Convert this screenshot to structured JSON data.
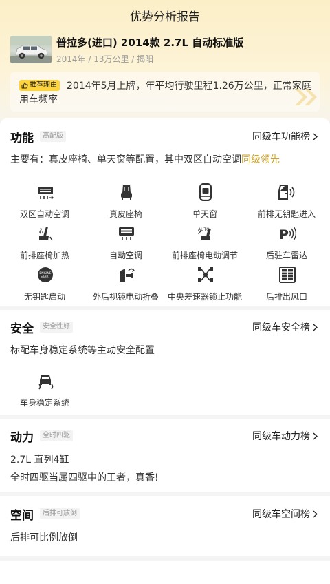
{
  "page": {
    "title": "优势分析报告"
  },
  "car": {
    "name": "普拉多(进口) 2014款 2.7L 自动标准版",
    "meta": "2014年 / 13万公里 / 揭阳"
  },
  "reason": {
    "tag": "推荐理由",
    "text": "2014年5月上牌，年平均行驶里程1.26万公里，正常家庭用车频率"
  },
  "sections": {
    "function": {
      "title": "功能",
      "tag": "高配版",
      "link": "同级车功能榜",
      "desc_prefix": "主要有：真皮座椅、单天窗等配置，其中双区自动空调",
      "desc_highlight": "同级领先",
      "features": [
        {
          "label": "双区自动空调",
          "icon": "dual-zone-ac-icon"
        },
        {
          "label": "真皮座椅",
          "icon": "leather-seat-icon"
        },
        {
          "label": "单天窗",
          "icon": "sunroof-icon"
        },
        {
          "label": "前排无钥匙进入",
          "icon": "keyless-entry-icon"
        },
        {
          "label": "前排座椅加热",
          "icon": "seat-heating-icon"
        },
        {
          "label": "自动空调",
          "icon": "auto-ac-icon"
        },
        {
          "label": "前排座椅电动调节",
          "icon": "power-seat-icon"
        },
        {
          "label": "后驻车雷达",
          "icon": "parking-radar-icon"
        },
        {
          "label": "无钥匙启动",
          "icon": "keyless-start-icon"
        },
        {
          "label": "外后视镜电动折叠",
          "icon": "mirror-fold-icon"
        },
        {
          "label": "中央差速器锁止功能",
          "icon": "diff-lock-icon"
        },
        {
          "label": "后排出风口",
          "icon": "rear-vent-icon"
        }
      ]
    },
    "safety": {
      "title": "安全",
      "tag": "安全性好",
      "link": "同级车安全榜",
      "desc": "标配车身稳定系统等主动安全配置",
      "features": [
        {
          "label": "车身稳定系统",
          "icon": "stability-control-icon"
        }
      ]
    },
    "power": {
      "title": "动力",
      "tag": "全时四驱",
      "link": "同级车动力榜",
      "line1": "2.7L 直列4缸",
      "line2": "全时四驱当属四驱中的王者，真香!"
    },
    "space": {
      "title": "空间",
      "tag": "后排可放倒",
      "link": "同级车空间榜",
      "desc": "后排可比例放倒"
    }
  },
  "colors": {
    "header_gradient_top": "#fbefc8",
    "tag_yellow": "#ffd33a",
    "highlight": "#c9a227",
    "icon": "#333333"
  }
}
